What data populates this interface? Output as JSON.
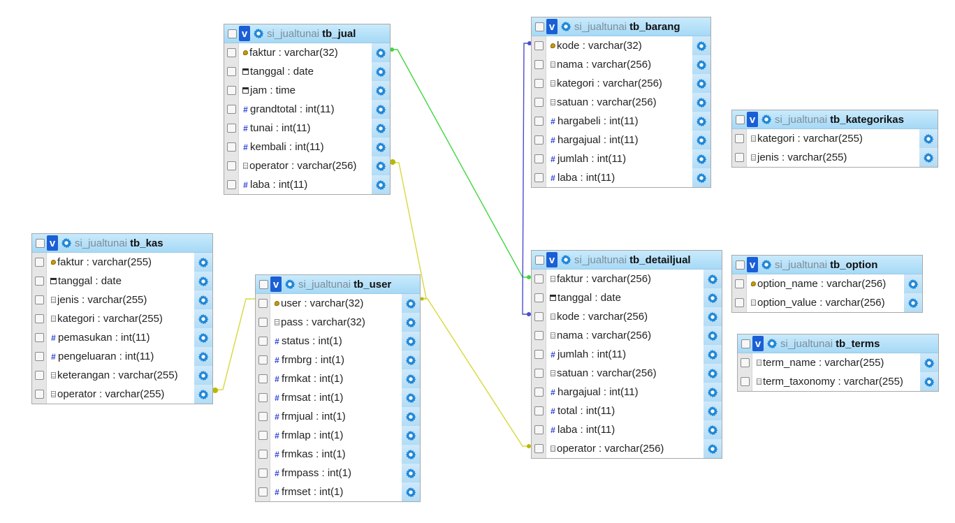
{
  "database": "si_jualtunai",
  "relation_colors": {
    "green": "#3fd63f",
    "blue": "#4b4bd1",
    "yellow": "#d8d83a",
    "yellow_end": "#b8b800"
  },
  "tables": [
    {
      "key": "tb_jual",
      "name": "tb_jual",
      "gear_rows": true,
      "fields": [
        {
          "label": "faktur : varchar(32)",
          "icon": "key-icon"
        },
        {
          "label": "tanggal : date",
          "icon": "date-icon"
        },
        {
          "label": "jam : time",
          "icon": "date-icon"
        },
        {
          "label": "grandtotal : int(11)",
          "icon": "number-icon"
        },
        {
          "label": "tunai : int(11)",
          "icon": "number-icon"
        },
        {
          "label": "kembali : int(11)",
          "icon": "number-icon"
        },
        {
          "label": "operator : varchar(256)",
          "icon": "text-icon"
        },
        {
          "label": "laba : int(11)",
          "icon": "number-icon"
        }
      ]
    },
    {
      "key": "tb_barang",
      "name": "tb_barang",
      "gear_rows": true,
      "fields": [
        {
          "label": "kode : varchar(32)",
          "icon": "key-icon"
        },
        {
          "label": "nama : varchar(256)",
          "icon": "text-icon"
        },
        {
          "label": "kategori : varchar(256)",
          "icon": "text-icon"
        },
        {
          "label": "satuan : varchar(256)",
          "icon": "text-icon"
        },
        {
          "label": "hargabeli : int(11)",
          "icon": "number-icon"
        },
        {
          "label": "hargajual : int(11)",
          "icon": "number-icon"
        },
        {
          "label": "jumlah : int(11)",
          "icon": "number-icon"
        },
        {
          "label": "laba : int(11)",
          "icon": "number-icon"
        }
      ]
    },
    {
      "key": "tb_kategorikas",
      "name": "tb_kategorikas",
      "gear_rows": true,
      "fields": [
        {
          "label": "kategori : varchar(255)",
          "icon": "text-icon"
        },
        {
          "label": "jenis : varchar(255)",
          "icon": "text-icon"
        }
      ]
    },
    {
      "key": "tb_kas",
      "name": "tb_kas",
      "gear_rows": true,
      "fields": [
        {
          "label": "faktur : varchar(255)",
          "icon": "key-icon"
        },
        {
          "label": "tanggal : date",
          "icon": "date-icon"
        },
        {
          "label": "jenis : varchar(255)",
          "icon": "text-icon"
        },
        {
          "label": "kategori : varchar(255)",
          "icon": "text-icon"
        },
        {
          "label": "pemasukan : int(11)",
          "icon": "number-icon"
        },
        {
          "label": "pengeluaran : int(11)",
          "icon": "number-icon"
        },
        {
          "label": "keterangan : varchar(255)",
          "icon": "text-icon"
        },
        {
          "label": "operator : varchar(255)",
          "icon": "text-icon"
        }
      ]
    },
    {
      "key": "tb_user",
      "name": "tb_user",
      "gear_rows": true,
      "fields": [
        {
          "label": "user : varchar(32)",
          "icon": "key-icon"
        },
        {
          "label": "pass : varchar(32)",
          "icon": "text-icon"
        },
        {
          "label": "status : int(1)",
          "icon": "number-icon"
        },
        {
          "label": "frmbrg : int(1)",
          "icon": "number-icon"
        },
        {
          "label": "frmkat : int(1)",
          "icon": "number-icon"
        },
        {
          "label": "frmsat : int(1)",
          "icon": "number-icon"
        },
        {
          "label": "frmjual : int(1)",
          "icon": "number-icon"
        },
        {
          "label": "frmlap : int(1)",
          "icon": "number-icon"
        },
        {
          "label": "frmkas : int(1)",
          "icon": "number-icon"
        },
        {
          "label": "frmpass : int(1)",
          "icon": "number-icon"
        },
        {
          "label": "frmset : int(1)",
          "icon": "number-icon"
        }
      ]
    },
    {
      "key": "tb_detailjual",
      "name": "tb_detailjual",
      "gear_rows": true,
      "fields": [
        {
          "label": "faktur : varchar(256)",
          "icon": "text-icon"
        },
        {
          "label": "tanggal : date",
          "icon": "date-icon"
        },
        {
          "label": "kode : varchar(256)",
          "icon": "text-icon"
        },
        {
          "label": "nama : varchar(256)",
          "icon": "text-icon"
        },
        {
          "label": "jumlah : int(11)",
          "icon": "number-icon"
        },
        {
          "label": "satuan : varchar(256)",
          "icon": "text-icon"
        },
        {
          "label": "hargajual : int(11)",
          "icon": "number-icon"
        },
        {
          "label": "total : int(11)",
          "icon": "number-icon"
        },
        {
          "label": "laba : int(11)",
          "icon": "number-icon"
        },
        {
          "label": "operator : varchar(256)",
          "icon": "text-icon"
        }
      ]
    },
    {
      "key": "tb_option",
      "name": "tb_option",
      "gear_rows": true,
      "fields": [
        {
          "label": "option_name : varchar(256)",
          "icon": "key-icon"
        },
        {
          "label": "option_value : varchar(256)",
          "icon": "text-icon"
        }
      ]
    },
    {
      "key": "tb_terms",
      "name": "tb_terms",
      "gear_rows": true,
      "fields": [
        {
          "label": "term_name : varchar(255)",
          "icon": "text-icon"
        },
        {
          "label": "term_taxonomy : varchar(255)",
          "icon": "text-icon"
        }
      ]
    }
  ]
}
